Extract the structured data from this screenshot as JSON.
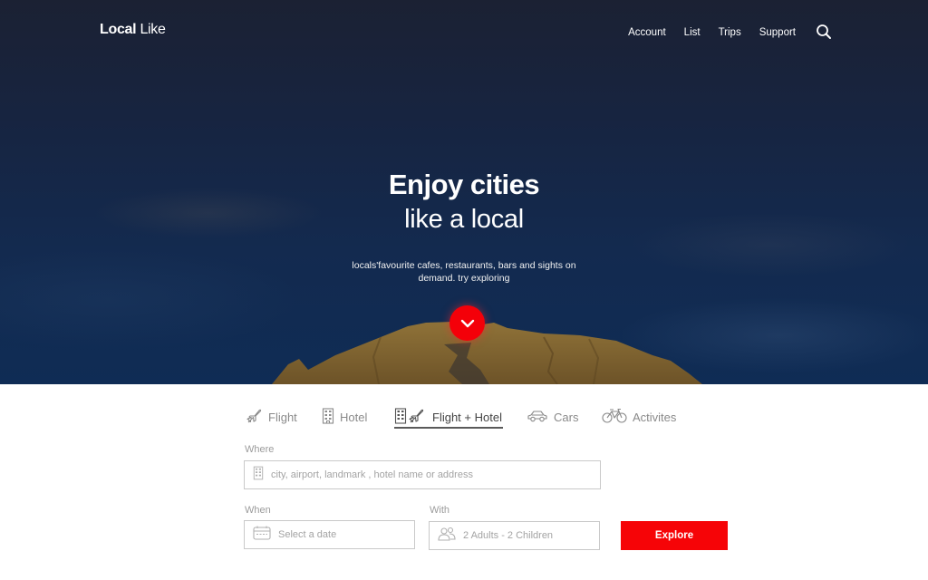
{
  "brand": {
    "part1": "Local",
    "part2": "Like"
  },
  "nav": {
    "links": [
      "Account",
      "List",
      "Trips",
      "Support"
    ],
    "search_icon": "search-icon"
  },
  "hero": {
    "title_line1": "Enjoy cities",
    "title_line2": "like a local",
    "subtitle": "locals'favourite cafes, restaurants, bars and sights on demand. try exploring",
    "scroll_icon": "chevron-down-icon"
  },
  "tabs": [
    {
      "label": "Flight",
      "icon": "plane-icon",
      "active": false
    },
    {
      "label": "Hotel",
      "icon": "building-icon",
      "active": false
    },
    {
      "label": "Flight + Hotel",
      "icon": "building-plane-icon",
      "active": true
    },
    {
      "label": "Cars",
      "icon": "car-icon",
      "active": false
    },
    {
      "label": "Activites",
      "icon": "bicycle-icon",
      "active": false
    }
  ],
  "form": {
    "where": {
      "label": "Where",
      "placeholder": "city, airport, landmark , hotel name or address",
      "icon": "building-icon"
    },
    "when": {
      "label": "When",
      "placeholder": "Select a date",
      "icon": "calendar-icon"
    },
    "with": {
      "label": "With",
      "value": "2 Adults - 2 Children",
      "icon": "people-icon"
    },
    "submit_label": "Explore"
  },
  "colors": {
    "accent": "#f40009",
    "hero_bg": "#132a4f",
    "tab_active_underline": "#5a5a5a"
  }
}
